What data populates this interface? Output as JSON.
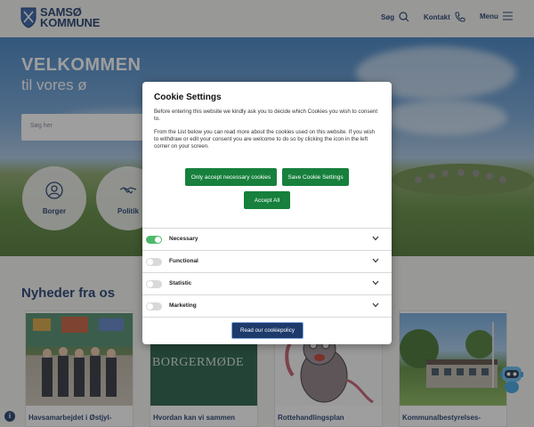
{
  "header": {
    "logo_line1": "SAMSØ",
    "logo_line2": "KOMMUNE",
    "search_label": "Søg",
    "contact_label": "Kontakt",
    "menu_label": "Menu"
  },
  "hero": {
    "title_line1": "VELKOMMEN",
    "title_line2": "til vores ø",
    "search_placeholder": "Søg her",
    "quick_links": [
      {
        "label": "Borger",
        "icon": "person-icon"
      },
      {
        "label": "Politik",
        "icon": "handshake-icon"
      }
    ]
  },
  "news": {
    "heading": "Nyheder fra os",
    "cards": [
      {
        "title": "Havsamarbejdet i Østjyl-"
      },
      {
        "title": "Hvordan kan vi sammen",
        "image_text": "BORGERMØDE"
      },
      {
        "title": "Rottehandlingsplan"
      },
      {
        "title": "Kommunalbestyrelses-"
      }
    ]
  },
  "cookie_modal": {
    "title": "Cookie Settings",
    "intro": "Before entering this website we kindly ask you to decide which Cookies you wish to consent to.",
    "details": "From the List below you can read more about the cookies used on this website. If you wish to withdraw or edit your consent you are welcome to do so by clicking the icon in the left corner on your screen.",
    "btn_necessary": "Only accept necessary cookies",
    "btn_save": "Save Cookie Settings",
    "btn_accept_all": "Accept All",
    "categories": [
      {
        "label": "Necessary",
        "enabled": true
      },
      {
        "label": "Functional",
        "enabled": false
      },
      {
        "label": "Statistic",
        "enabled": false
      },
      {
        "label": "Marketing",
        "enabled": false
      }
    ],
    "policy_button": "Read our cookiepolicy"
  },
  "colors": {
    "brand_blue": "#1d3a6b",
    "accept_green": "#16803c",
    "toggle_on": "#4cba6a"
  },
  "floating": {
    "info_icon": "i"
  }
}
